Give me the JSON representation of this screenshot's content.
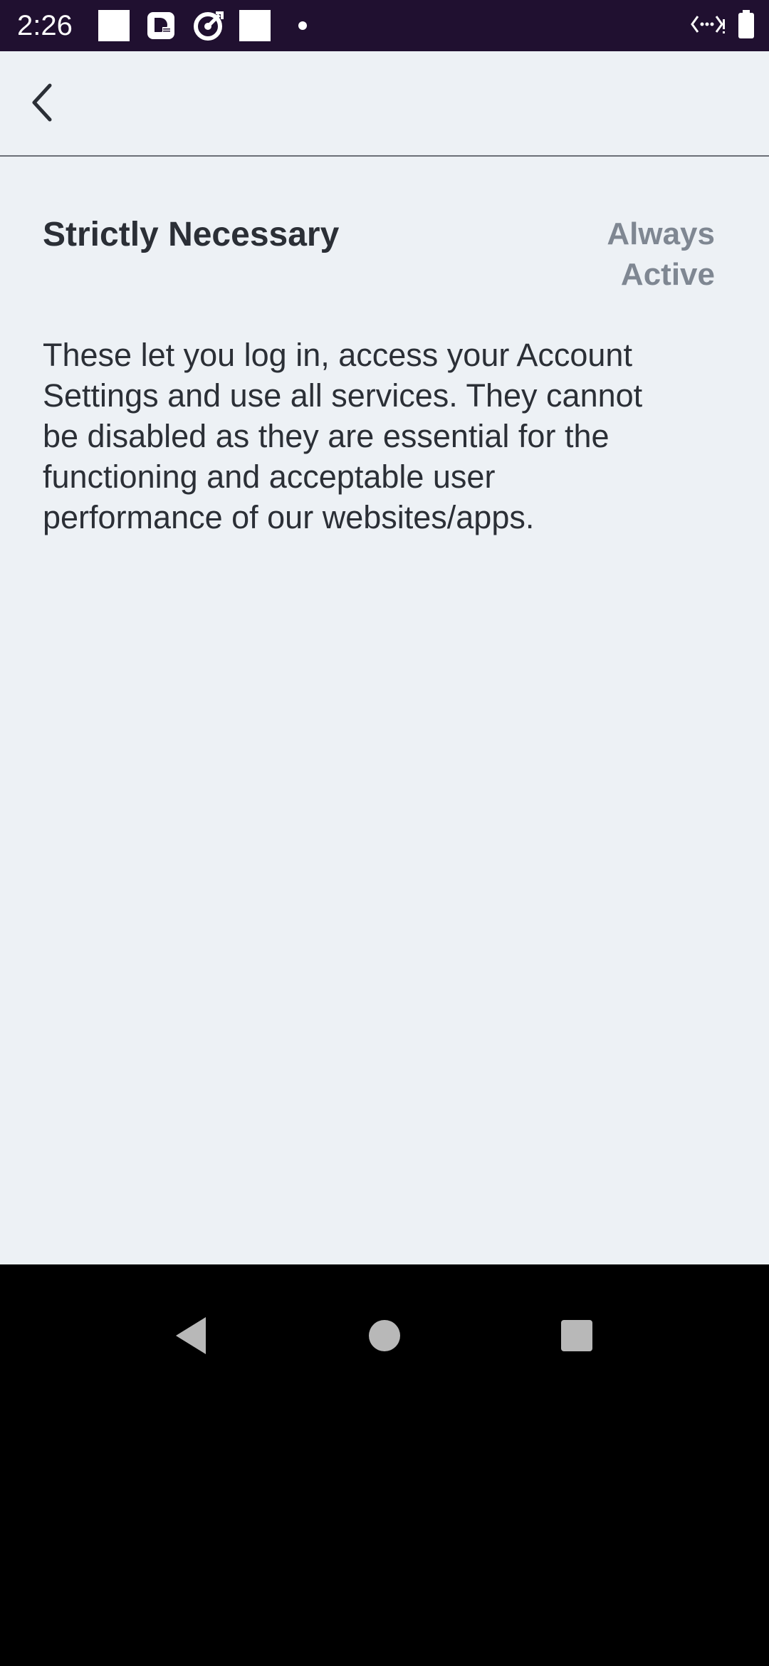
{
  "status_bar": {
    "time": "2:26",
    "notification_icons": [
      "white-square-icon",
      "news-app-icon",
      "target-app-icon",
      "white-square-icon",
      "dot-icon"
    ],
    "right_icons": [
      "data-saver-icon",
      "battery-icon"
    ]
  },
  "header": {
    "back_icon": "chevron-left-icon"
  },
  "content": {
    "title": "Strictly Necessary",
    "status_line1": "Always",
    "status_line2": "Active",
    "description": "These let you log in, access your Account Settings and use all services. They cannot be disabled as they are essential for the functioning and acceptable user performance of our websites/apps."
  },
  "colors": {
    "status_bar_bg": "#201030",
    "page_bg": "#edf1f5",
    "text_primary": "#2b2f36",
    "text_muted": "#7f8792",
    "nav_bg": "#000000",
    "nav_icon": "#b8b8b8"
  },
  "nav_bar": {
    "icons": [
      "nav-back-icon",
      "nav-home-icon",
      "nav-recents-icon"
    ]
  }
}
